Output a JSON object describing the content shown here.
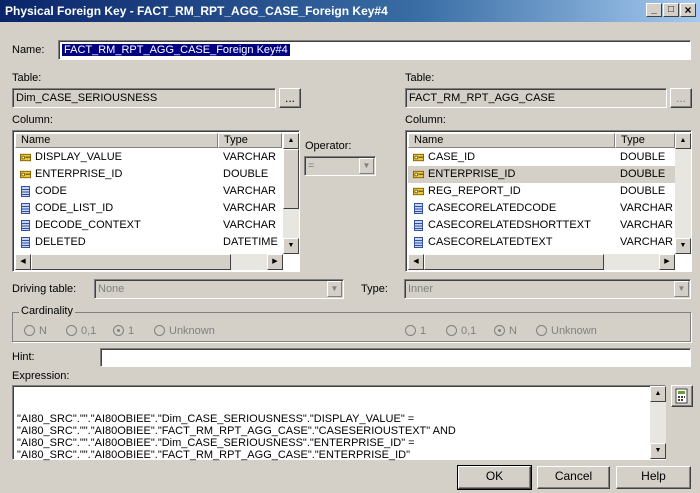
{
  "window": {
    "title": "Physical Foreign Key - FACT_RM_RPT_AGG_CASE_Foreign Key#4",
    "min": "_",
    "max": "□",
    "close": "×"
  },
  "name": {
    "label": "Name:",
    "value": "FACT_RM_RPT_AGG_CASE_Foreign Key#4"
  },
  "left": {
    "table_label": "Table:",
    "table_value": "Dim_CASE_SERIOUSNESS",
    "browse": "...",
    "column_label": "Column:",
    "headers": {
      "name": "Name",
      "type": "Type"
    },
    "rows": [
      {
        "name": "DISPLAY_VALUE",
        "type": "VARCHAR",
        "icon": "key-icon"
      },
      {
        "name": "ENTERPRISE_ID",
        "type": "DOUBLE",
        "icon": "key-icon"
      },
      {
        "name": "CODE",
        "type": "VARCHAR",
        "icon": "column-icon"
      },
      {
        "name": "CODE_LIST_ID",
        "type": "VARCHAR",
        "icon": "column-icon"
      },
      {
        "name": "DECODE_CONTEXT",
        "type": "VARCHAR",
        "icon": "column-icon"
      },
      {
        "name": "DELETED",
        "type": "DATETIME",
        "icon": "column-icon"
      }
    ]
  },
  "right": {
    "table_label": "Table:",
    "table_value": "FACT_RM_RPT_AGG_CASE",
    "browse": "...",
    "column_label": "Column:",
    "headers": {
      "name": "Name",
      "type": "Type"
    },
    "rows": [
      {
        "name": "CASE_ID",
        "type": "DOUBLE",
        "icon": "key-icon"
      },
      {
        "name": "ENTERPRISE_ID",
        "type": "DOUBLE",
        "icon": "key-icon"
      },
      {
        "name": "REG_REPORT_ID",
        "type": "DOUBLE",
        "icon": "key-icon"
      },
      {
        "name": "CASECORELATEDCODE",
        "type": "VARCHAR",
        "icon": "column-icon"
      },
      {
        "name": "CASECORELATEDSHORTTEXT",
        "type": "VARCHAR",
        "icon": "column-icon"
      },
      {
        "name": "CASECORELATEDTEXT",
        "type": "VARCHAR",
        "icon": "column-icon"
      }
    ]
  },
  "operator": {
    "label": "Operator:",
    "value": "="
  },
  "driving": {
    "label": "Driving table:",
    "value": "None"
  },
  "join_type": {
    "label": "Type:",
    "value": "Inner"
  },
  "cardinality": {
    "label": "Cardinality",
    "left": [
      {
        "label": "N",
        "checked": false
      },
      {
        "label": "0,1",
        "checked": false
      },
      {
        "label": "1",
        "checked": true
      },
      {
        "label": "Unknown",
        "checked": false
      }
    ],
    "right": [
      {
        "label": "1",
        "checked": false
      },
      {
        "label": "0,1",
        "checked": false
      },
      {
        "label": "N",
        "checked": true
      },
      {
        "label": "Unknown",
        "checked": false
      }
    ]
  },
  "hint": {
    "label": "Hint:",
    "value": ""
  },
  "expression": {
    "label": "Expression:",
    "lines": [
      "\"AI80_SRC\".\"\".\"AI80OBIEE\".\"Dim_CASE_SERIOUSNESS\".\"DISPLAY_VALUE\" =",
      "\"AI80_SRC\".\"\".\"AI80OBIEE\".\"FACT_RM_RPT_AGG_CASE\".\"CASESERIOUSTEXT\" AND",
      "\"AI80_SRC\".\"\".\"AI80OBIEE\".\"Dim_CASE_SERIOUSNESS\".\"ENTERPRISE_ID\" =",
      "\"AI80_SRC\".\"\".\"AI80OBIEE\".\"FACT_RM_RPT_AGG_CASE\".\"ENTERPRISE_ID\""
    ]
  },
  "buttons": {
    "ok": "OK",
    "cancel": "Cancel",
    "help": "Help"
  }
}
